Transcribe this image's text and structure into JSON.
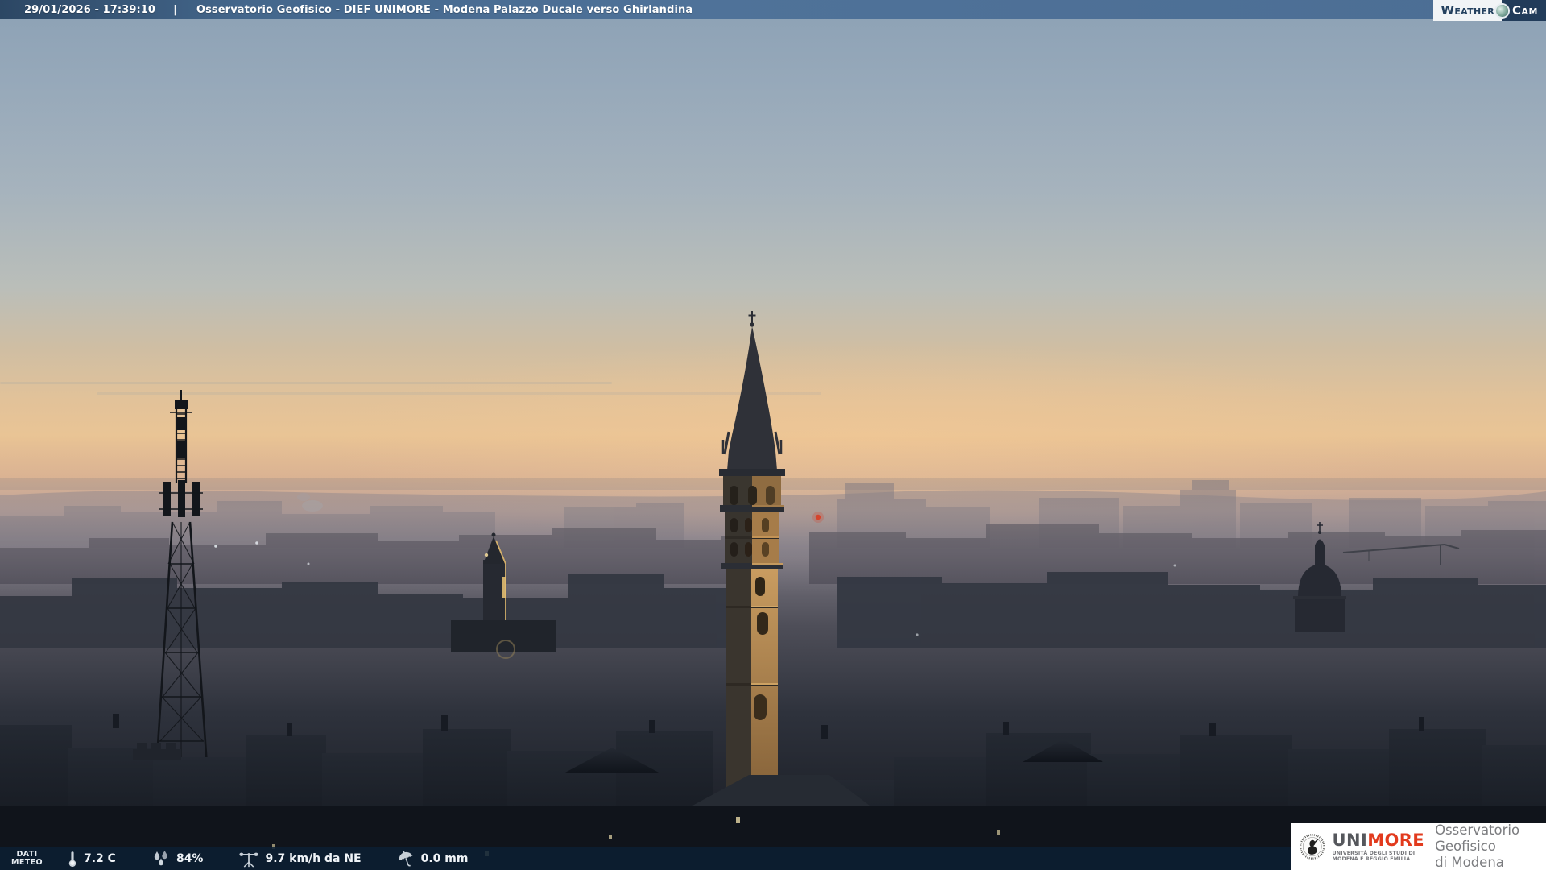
{
  "header": {
    "timestamp": "29/01/2026 - 17:39:10",
    "separator": "|",
    "title": "Osservatorio Geofisico - DIEF UNIMORE - Modena Palazzo Ducale verso Ghirlandina"
  },
  "weathercam": {
    "weather": "Weather",
    "cam": "Cam"
  },
  "meteo": {
    "label_line1": "DATI",
    "label_line2": "METEO",
    "items": [
      {
        "icon": "thermometer-icon",
        "value": "7.2 C"
      },
      {
        "icon": "water-drops-icon",
        "value": "84%"
      },
      {
        "icon": "anemometer-icon",
        "value": "9.7 km/h da NE"
      },
      {
        "icon": "umbrella-icon",
        "value": "0.0 mm"
      }
    ]
  },
  "unimore": {
    "uni": "UNI",
    "more": "MORE",
    "subtitle_line1": "UNIVERSITÀ DEGLI STUDI DI",
    "subtitle_line2": "MODENA E REGGIO EMILIA",
    "org_line1": "Osservatorio Geofisico",
    "org_line2": "di Modena"
  },
  "colors": {
    "topbar_blue": "#4d7096",
    "footer_navy": "#0b1f33",
    "unimore_red": "#e23a1d",
    "logo_navy": "#223c5a",
    "sky_top": "#8ca1b5",
    "sunset_orange": "#e9c495",
    "tower_gold": "#c99c60"
  }
}
